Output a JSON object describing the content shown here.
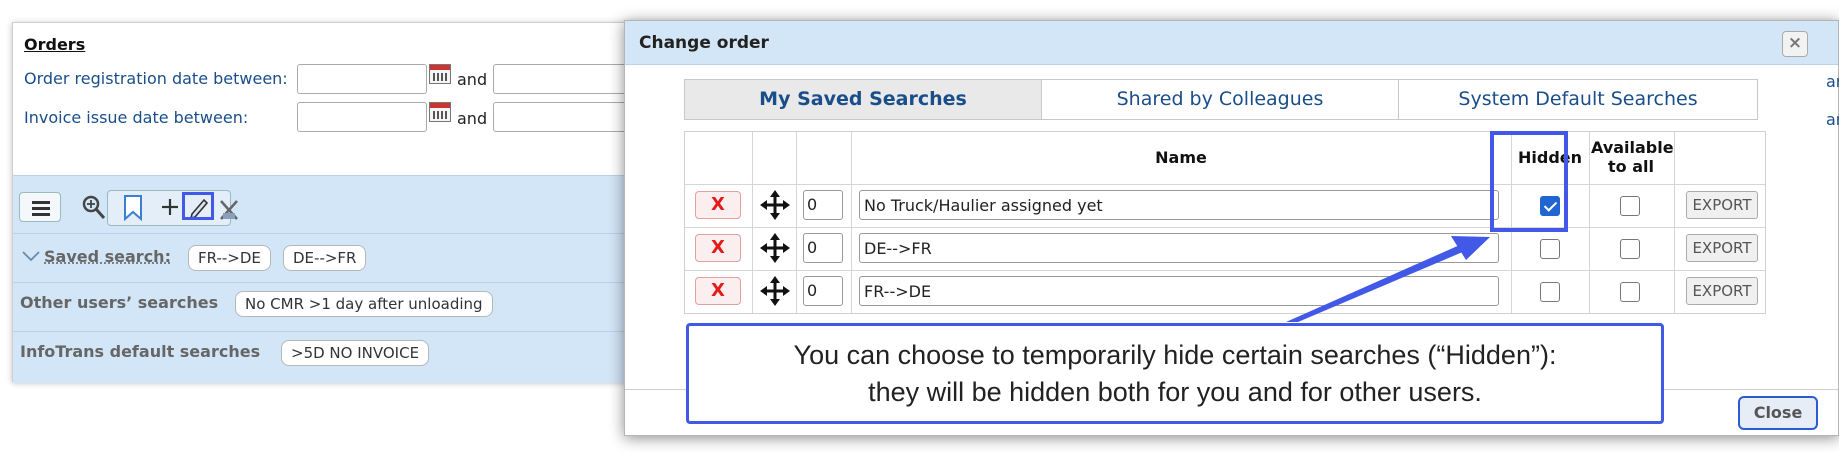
{
  "orders": {
    "title": "Orders",
    "reg_date_label": "Order registration date between:",
    "invoice_date_label": "Invoice issue date between:",
    "and_label": "and",
    "saved_search_label": "Saved search:",
    "saved_pills": [
      "FR-->DE",
      "DE-->FR"
    ],
    "other_users_label": "Other users’ searches",
    "other_users_pills": [
      "No CMR >1 day after unloading"
    ],
    "default_label": "InfoTrans default searches",
    "default_pills": [
      ">5D NO INVOICE"
    ],
    "cutoff_text": [
      "an",
      "an"
    ]
  },
  "modal": {
    "title": "Change order",
    "close_x": "×",
    "tabs": [
      "My Saved Searches",
      "Shared by Colleagues",
      "System Default Searches"
    ],
    "active_tab": 0,
    "columns": {
      "name": "Name",
      "hidden": "Hidden",
      "available": "Available to all"
    },
    "rows": [
      {
        "order": "0",
        "name": "No Truck/Haulier assigned yet",
        "hidden": true,
        "available": false
      },
      {
        "order": "0",
        "name": "DE-->FR",
        "hidden": false,
        "available": false
      },
      {
        "order": "0",
        "name": "FR-->DE",
        "hidden": false,
        "available": false
      }
    ],
    "delete_label": "X",
    "export_label": "EXPORT",
    "close_label": "Close"
  },
  "annotation": {
    "line1": "You can choose to temporarily hide certain searches (“Hidden”):",
    "line2": "they will be hidden both for you and for other users.",
    "color": "#4159e6"
  }
}
